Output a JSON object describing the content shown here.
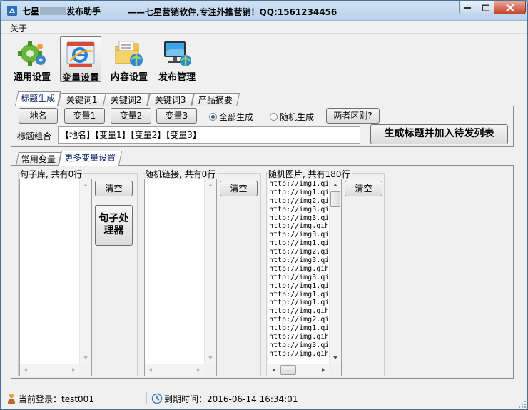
{
  "window": {
    "title_prefix": "七星",
    "title_suffix": "发布助手",
    "slogan": "——七星营销软件,专注外推营销！QQ:1561234456"
  },
  "menu": {
    "about": "关于"
  },
  "toolbar": {
    "items": [
      {
        "label": "通用设置",
        "icon": "gear-icon"
      },
      {
        "label": "变量设置",
        "icon": "ie-document-icon",
        "selected": true
      },
      {
        "label": "内容设置",
        "icon": "folder-globe-icon"
      },
      {
        "label": "发布管理",
        "icon": "monitor-globe-icon"
      }
    ]
  },
  "top_tabs": [
    "标题生成",
    "关键词1",
    "关键词2",
    "关键词3",
    "产品摘要"
  ],
  "title_gen": {
    "buttons": [
      "地名",
      "变量1",
      "变量2",
      "变量3"
    ],
    "radio_all": "全部生成",
    "radio_random": "随机生成",
    "diff_button": "两者区别?",
    "combo_label": "标题组合",
    "combo_value": "【地名】【变量1】【变量2】【变量3】",
    "generate_button": "生成标题并加入待发列表"
  },
  "sub_tabs": [
    "常用变量",
    "更多变量设置"
  ],
  "groups": {
    "sentences": {
      "title": "句子库, 共有0行",
      "clear": "清空",
      "processor": "句子处理器"
    },
    "links": {
      "title": "随机链接, 共有0行",
      "clear": "清空"
    },
    "images": {
      "title": "随机图片, 共有180行",
      "clear": "清空",
      "lines": [
        "http://img1.qi",
        "http://img1.qi",
        "http://img2.qi",
        "http://img3.qi",
        "http://img3.qi",
        "http://img.qih",
        "http://img3.qi",
        "http://img1.qi",
        "http://img2.qi",
        "http://img3.qi",
        "http://img.qih",
        "http://img3.qi",
        "http://img1.qi",
        "http://img1.qi",
        "http://img1.qi",
        "http://img.qih",
        "http://img2.qi",
        "http://img1.qi",
        "http://img.qih",
        "http://img3.qi",
        "http://img.qih"
      ]
    }
  },
  "status": {
    "login": "当前登录：test001",
    "expire": "到期时间：2016-06-14 16:34:01"
  }
}
